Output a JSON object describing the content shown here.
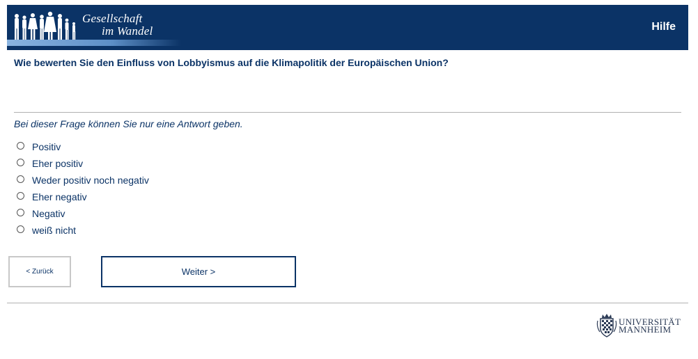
{
  "header": {
    "logo_line1": "Gesellschaft",
    "logo_line2": "im Wandel",
    "help_label": "Hilfe"
  },
  "question": {
    "text": "Wie bewerten Sie den Einfluss von Lobbyismus auf die Klimapolitik der Europäischen Union?",
    "instruction": "Bei dieser Frage können Sie nur eine Antwort geben.",
    "options": [
      {
        "label": "Positiv",
        "selected": false
      },
      {
        "label": "Eher positiv",
        "selected": false
      },
      {
        "label": "Weder positiv noch negativ",
        "selected": false
      },
      {
        "label": "Eher negativ",
        "selected": false
      },
      {
        "label": "Negativ",
        "selected": false
      },
      {
        "label": "weiß nicht",
        "selected": false
      }
    ]
  },
  "navigation": {
    "back_label": "< Zurück",
    "next_label": "Weiter >"
  },
  "footer": {
    "university_line1": "UNIVERSITÄT",
    "university_line2": "MANNHEIM"
  },
  "colors": {
    "brand_navy": "#0b3366",
    "divider": "#b0b0b0"
  }
}
